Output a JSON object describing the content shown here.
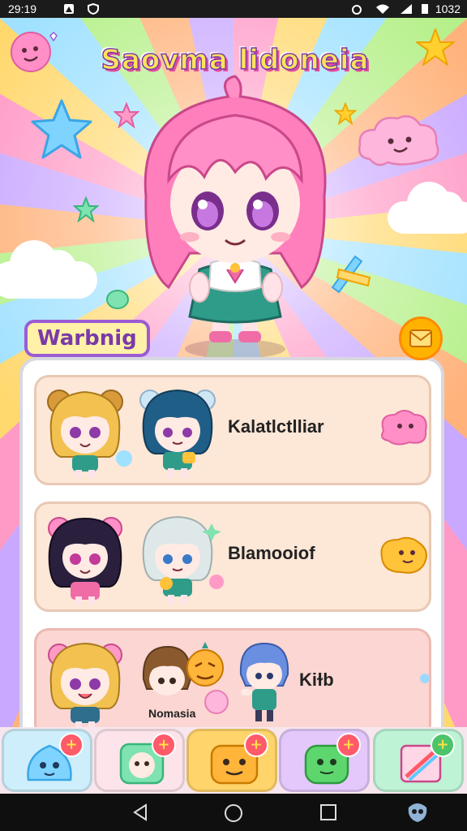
{
  "status_bar": {
    "time": "29:19",
    "right_text": "1032",
    "icons": [
      "app-icon",
      "shield-icon",
      "alarm-icon",
      "wifi-icon",
      "signal-icon",
      "battery-icon"
    ]
  },
  "title": "Saovma lidoneia",
  "section_label": "Warbnig",
  "entries": [
    {
      "label": "Kalatlctlliar",
      "sub": ""
    },
    {
      "label": "Blamooiof",
      "sub": ""
    },
    {
      "label": "Kiɫb",
      "sub": "Nomasia"
    }
  ],
  "bottom_buttons": [
    {
      "icon": "blue-slime-icon",
      "badge": "+",
      "color": "#cfeefb"
    },
    {
      "icon": "green-pal-icon",
      "badge": "+",
      "color": "#fde4ea"
    },
    {
      "icon": "orange-cat-icon",
      "badge": "+",
      "color": "#ffd46a"
    },
    {
      "icon": "green-slime-icon",
      "badge": "+",
      "color": "#e4c8fb"
    },
    {
      "icon": "box-sword-icon",
      "badge": "+",
      "color": "#bff3d6"
    }
  ],
  "nav": [
    "back-icon",
    "home-icon",
    "recents-icon",
    "assistant-icon"
  ],
  "colors": {
    "accent": "#9b5cd4",
    "panel": "#ffffff",
    "entry": "#fde7d7"
  }
}
